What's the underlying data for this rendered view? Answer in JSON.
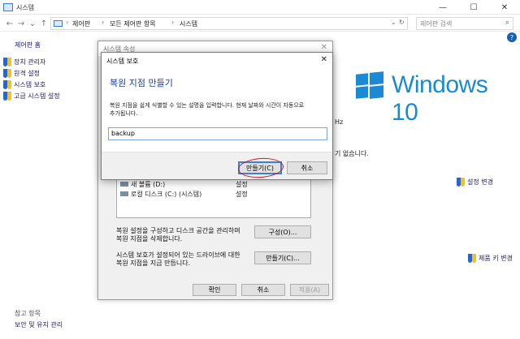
{
  "window": {
    "title": "시스템",
    "controls": {
      "minimize": "—",
      "maximize": "☐",
      "close": "✕"
    }
  },
  "address": {
    "crumbs": [
      "제어판",
      "모든 제어판 항목",
      "시스템"
    ],
    "search_placeholder": "제어판 검색"
  },
  "left_pane": {
    "home": "제어판 홈",
    "items": [
      "장치 관리자",
      "원격 설정",
      "시스템 보호",
      "고급 시스템 설정"
    ],
    "see_also_title": "참고 항목",
    "see_also_items": [
      "보안 및 유지 관리"
    ]
  },
  "background": {
    "brand_text": "Windows 10",
    "fragment_hz": "Hz",
    "fragment_none": "기 없습니다.",
    "change_settings": "설정 변경",
    "change_product_key": "제품 키 변경",
    "brand_color": "#1a8ad4"
  },
  "system_properties": {
    "title": "시스템 속성",
    "list_rows": [
      {
        "name": "새 볼륨 (D:)",
        "status": "설정"
      },
      {
        "name": "로컬 디스크 (C:) (시스템)",
        "status": "설정"
      }
    ],
    "configure_desc": [
      "복원 설정을 구성하고 디스크 공간을 관리하며",
      "복원 지점을 삭제합니다."
    ],
    "configure_button": "구성(O)...",
    "create_desc": [
      "시스템 보호가 설정되어 있는 드라이브에 대한",
      "복원 지점을 지금 만듭니다."
    ],
    "create_button": "만들기(C)...",
    "ok": "확인",
    "cancel": "취소",
    "apply": "적용(A)"
  },
  "create_dialog": {
    "title": "시스템 보호",
    "heading": "복원 지점 만들기",
    "instruction_line1": "복원 지점을 쉽게 식별할 수 있는 설명을 입력합니다. 현재 날짜와 시간이 자동으로",
    "instruction_line2": "추가됩니다.",
    "input_value": "backup",
    "create_button": "만들기(C)",
    "cancel_button": "취소",
    "accent_color": "#1e3e9c",
    "annotation_color": "#d21a1a"
  }
}
